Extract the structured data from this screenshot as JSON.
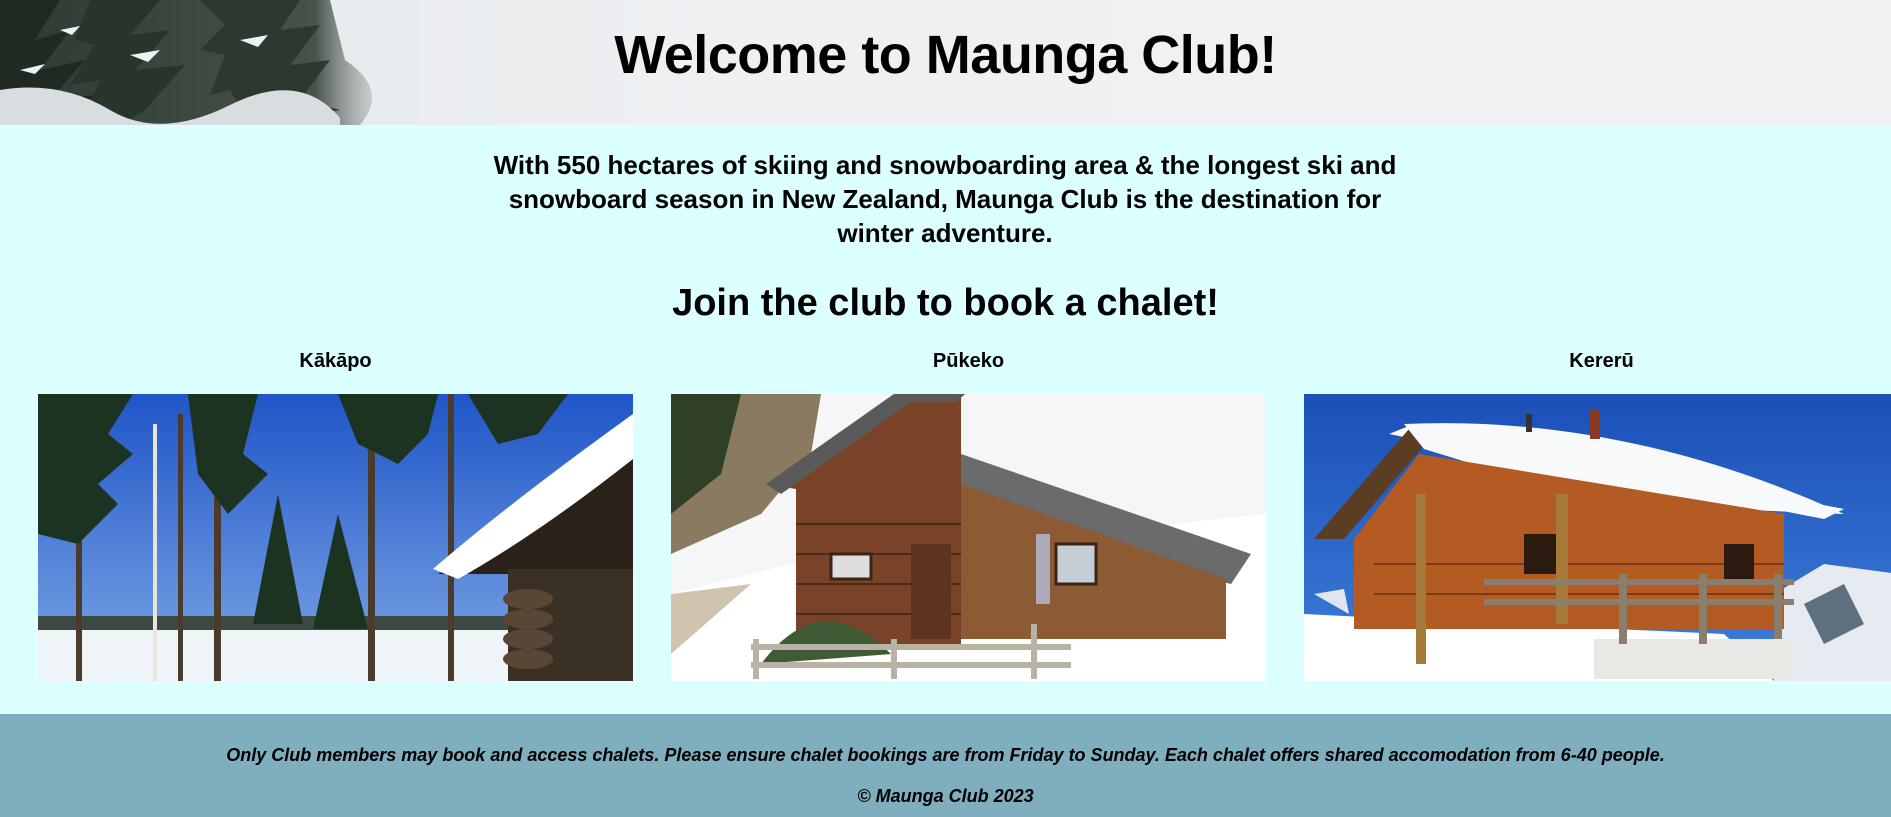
{
  "header": {
    "title": "Welcome to Maunga Club!"
  },
  "intro": {
    "text": "With 550 hectares of skiing and snowboarding area & the longest ski and snowboard season in New Zealand, Maunga Club is the destination for winter adventure."
  },
  "join_heading": "Join the club to book a chalet!",
  "chalets": [
    {
      "name": "Kākāpo"
    },
    {
      "name": "Pūkeko"
    },
    {
      "name": "Kererū"
    }
  ],
  "footer": {
    "note": "Only Club members may book and access chalets. Please ensure chalet bookings are from Friday to Sunday. Each chalet offers shared accomodation from 6-40 people.",
    "copyright": "© Maunga Club 2023"
  },
  "colors": {
    "page_background": "#dcffff",
    "footer_background": "#7faebf"
  }
}
